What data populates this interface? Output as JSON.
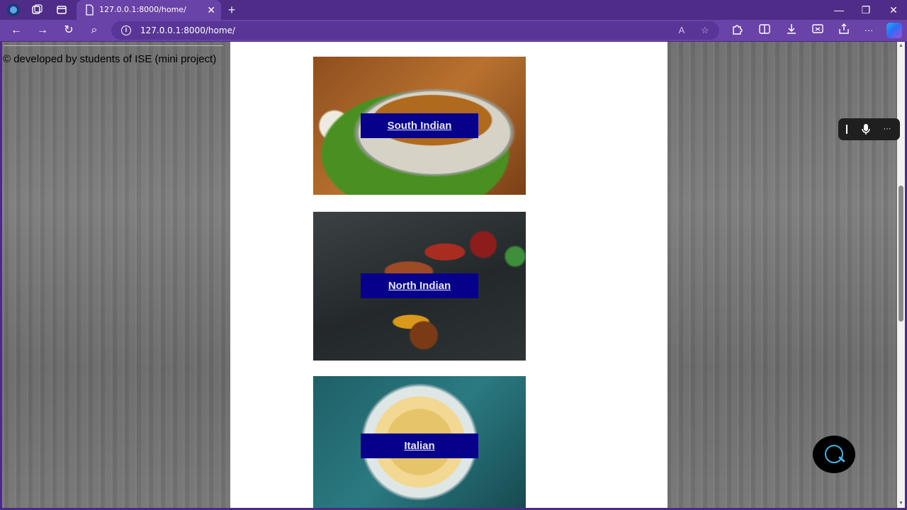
{
  "browser": {
    "tab_title": "127.0.0.1:8000/home/",
    "tab_close": "✕",
    "new_tab": "+",
    "url": "127.0.0.1:8000/home/",
    "window_controls": {
      "minimize": "—",
      "restore": "❐",
      "close": "✕"
    },
    "toolbar": {
      "back": "←",
      "forward": "→",
      "refresh": "↻",
      "search": "⌕",
      "more": "···"
    }
  },
  "page": {
    "footer_text": "© developed by students of ISE (mini project)",
    "cuisines": [
      {
        "label": "South Indian"
      },
      {
        "label": "North Indian"
      },
      {
        "label": "Italian"
      }
    ]
  },
  "voice_bar": {
    "more": "···"
  },
  "colors": {
    "chrome_purple": "#4f2c87",
    "toolbar_purple": "#6a43a8",
    "button_navy": "#06008a",
    "content_bg": "#ffffff"
  }
}
